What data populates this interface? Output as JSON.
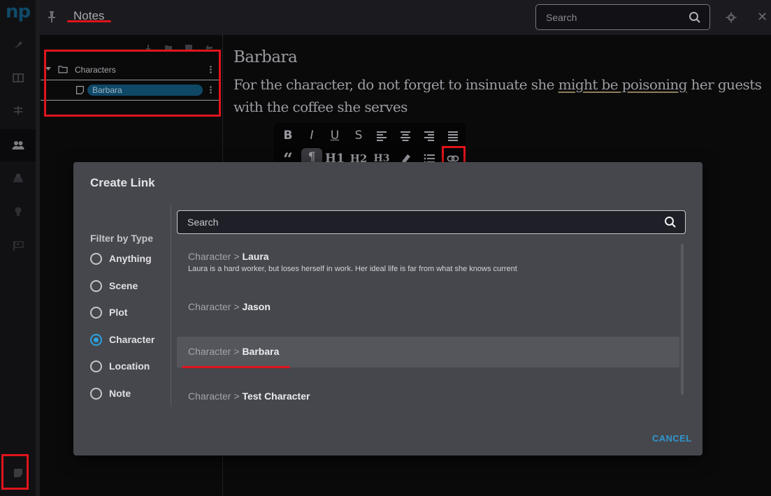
{
  "app": {
    "logo": "np",
    "title": "Notes",
    "accent_color": "#2aa3e0",
    "highlight_color": "#e0141c"
  },
  "rail": {
    "items": [
      {
        "name": "write",
        "icon": "pen-nib-icon"
      },
      {
        "name": "board",
        "icon": "columns-icon"
      },
      {
        "name": "timeline",
        "icon": "timeline-icon"
      },
      {
        "name": "characters",
        "icon": "users-icon",
        "active": true
      },
      {
        "name": "locations",
        "icon": "map-marker-icon"
      },
      {
        "name": "ideas",
        "icon": "lightbulb-icon"
      },
      {
        "name": "goals",
        "icon": "flag-checkered-icon"
      },
      {
        "name": "notes",
        "icon": "sticky-note-icon"
      }
    ]
  },
  "topbar": {
    "search_placeholder": "Search",
    "search_value": ""
  },
  "tree": {
    "toolbar": [
      "download-icon",
      "new-folder-icon",
      "new-note-icon",
      "back-icon"
    ],
    "folders": [
      {
        "label": "Characters",
        "expanded": true,
        "items": [
          {
            "label": "Barbara",
            "selected": true
          }
        ]
      }
    ]
  },
  "editor": {
    "heading": "Barbara",
    "body_before": "For the character, do not forget to insinuate she ",
    "body_link": "might be poisoning",
    "body_after": " her guests with the coffee she serves"
  },
  "format_toolbar": {
    "row1": [
      "B",
      "I",
      "U",
      "S",
      "align-left",
      "align-center",
      "align-right",
      "justify"
    ],
    "row2": [
      "quote",
      "paragraph",
      "H1",
      "H2",
      "H3",
      "highlighter",
      "list",
      "link"
    ],
    "active": "paragraph"
  },
  "modal": {
    "title": "Create Link",
    "filter_title": "Filter by Type",
    "filters": [
      {
        "label": "Anything",
        "checked": false
      },
      {
        "label": "Scene",
        "checked": false
      },
      {
        "label": "Plot",
        "checked": false
      },
      {
        "label": "Character",
        "checked": true
      },
      {
        "label": "Location",
        "checked": false
      },
      {
        "label": "Note",
        "checked": false
      }
    ],
    "search_placeholder": "Search",
    "search_value": "",
    "results": [
      {
        "type": "Character",
        "sep": ">",
        "name": "Laura",
        "description": "Laura is a hard worker, but loses herself in work. Her ideal life is far from what she knows current",
        "selected": false
      },
      {
        "type": "Character",
        "sep": ">",
        "name": "Jason",
        "description": "",
        "selected": false
      },
      {
        "type": "Character",
        "sep": ">",
        "name": "Barbara",
        "description": "",
        "selected": true
      },
      {
        "type": "Character",
        "sep": ">",
        "name": "Test Character",
        "description": "",
        "selected": false
      }
    ],
    "cancel_label": "CANCEL"
  }
}
